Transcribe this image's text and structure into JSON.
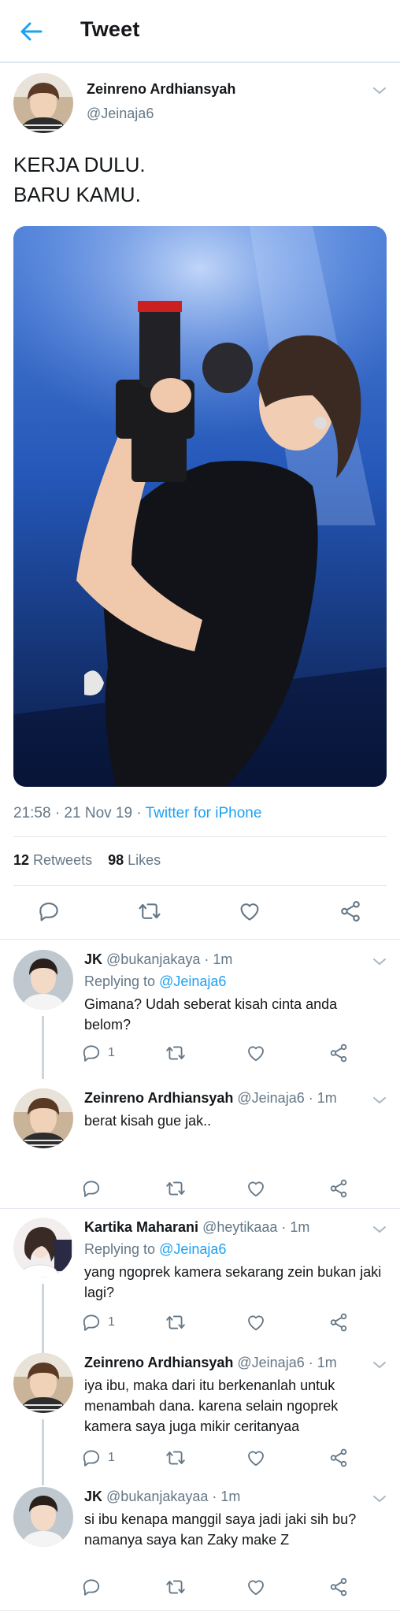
{
  "header": {
    "title": "Tweet"
  },
  "main_tweet": {
    "name": "Zeinreno Ardhiansyah",
    "handle": "@Jeinaja6",
    "text_line1": "KERJA DULU.",
    "text_line2": "BARU KAMU.",
    "time": "21:58 · 21 Nov 19 · ",
    "source": "Twitter for iPhone",
    "retweets_count": "12",
    "retweets_label": "Retweets",
    "likes_count": "98",
    "likes_label": "Likes"
  },
  "replies": [
    {
      "name": "JK",
      "handle": "@bukanjakaya · 1m",
      "replying_label": "Replying to ",
      "replying_to": "@Jeinaja6",
      "text": "Gimana? Udah seberat kisah cinta anda belom?",
      "reply_count": "1"
    },
    {
      "name": "Zeinreno Ardhiansyah",
      "handle": "@Jeinaja6 · 1m",
      "text": "berat kisah gue jak..",
      "reply_count": ""
    },
    {
      "name": "Kartika Maharani",
      "handle": "@heytikaaa · 1m",
      "replying_label": "Replying to ",
      "replying_to": "@Jeinaja6",
      "text": "yang ngoprek kamera sekarang zein bukan jaki lagi?",
      "reply_count": "1"
    },
    {
      "name": "Zeinreno Ardhiansyah",
      "handle": "@Jeinaja6 · 1m",
      "text": "iya ibu, maka dari itu berkenanlah untuk menambah dana. karena selain ngoprek kamera saya juga mikir ceritanyaa",
      "reply_count": "1"
    },
    {
      "name": "JK",
      "handle": "@bukanjakayaa · 1m",
      "text": "si ibu kenapa manggil saya jadi jaki sih bu? namanya saya kan Zaky make Z",
      "reply_count": ""
    }
  ],
  "icons": {
    "back": "arrow-left-icon",
    "chevron": "chevron-down-icon",
    "reply": "reply-icon",
    "retweet": "retweet-icon",
    "like": "heart-icon",
    "share": "share-icon"
  },
  "colors": {
    "accent": "#1da1f2",
    "secondary_text": "#657786",
    "divider": "#e1e8ed"
  }
}
